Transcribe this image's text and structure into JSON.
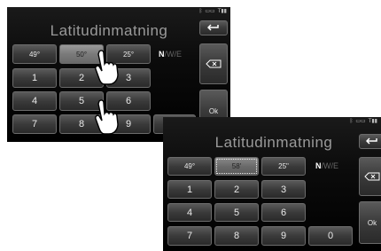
{
  "screen1": {
    "title": "Latitudinmatning",
    "status": {
      "bluetooth": "bluetooth-icon",
      "battery": "battery-icon",
      "signal": "signal-icon"
    },
    "degree_buttons": [
      "49°",
      "50°",
      "25°"
    ],
    "selected_index": 1,
    "hemisphere": {
      "active": "N",
      "inactive": "/W/E"
    },
    "digits": [
      "1",
      "2",
      "3",
      "4",
      "5",
      "6",
      "7",
      "8",
      "9"
    ],
    "side": {
      "back": "back-arrow-icon",
      "delete": "backspace-icon",
      "ok": "Ok"
    }
  },
  "screen2": {
    "title": "Latitudinmatning",
    "status": {
      "bluetooth": "bluetooth-icon",
      "battery": "battery-icon",
      "signal": "signal-icon"
    },
    "degree_buttons": [
      "49°",
      "58'",
      "25\""
    ],
    "selected_index": 1,
    "hemisphere": {
      "active": "N",
      "inactive": "/W/E"
    },
    "digits": [
      "1",
      "2",
      "3",
      "4",
      "5",
      "6",
      "7",
      "8",
      "9",
      "0"
    ],
    "side": {
      "back": "back-arrow-icon",
      "delete": "backspace-icon",
      "ok": "Ok"
    }
  },
  "colors": {
    "background": "#000000",
    "key": "#3a3a3a",
    "selected_key": "#8a8a8a",
    "title": "#9a9a9a"
  }
}
